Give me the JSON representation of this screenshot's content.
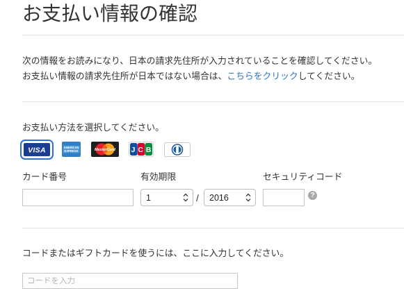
{
  "page": {
    "title": "お支払い情報の確認"
  },
  "notice": {
    "line1": "次の情報をお読みになり、日本の請求先住所が入力されていることを確認してください。",
    "line2_before_link": "お支払い情報の請求先住所が日本ではない場合は、",
    "line2_link": "こちらをクリック",
    "line2_after_link": "してください。"
  },
  "payment": {
    "prompt": "お支払い方法を選択してください。",
    "cards": [
      {
        "icon": "visa-card-icon",
        "logo_text": "VISA",
        "selected": true
      },
      {
        "icon": "amex-card-icon",
        "logo_lines": [
          "AMERICAN",
          "EXPRESS"
        ],
        "selected": false
      },
      {
        "icon": "mastercard-card-icon",
        "logo_text": "MasterCard",
        "selected": false
      },
      {
        "icon": "jcb-card-icon",
        "logo_text": "JCB",
        "selected": false
      },
      {
        "icon": "diners-club-card-icon",
        "selected": false
      }
    ],
    "fields": {
      "card_number": {
        "label": "カード番号",
        "value": ""
      },
      "expiry": {
        "label": "有効期限",
        "month": "1",
        "separator": "/",
        "year": "2016"
      },
      "security_code": {
        "label": "セキュリティコード",
        "value": "",
        "help_icon": "question-mark-icon"
      }
    }
  },
  "redeem": {
    "prompt": "コードまたはギフトカードを使うには、ここに入力してください。",
    "placeholder": "コードを入力",
    "value": ""
  },
  "colors": {
    "text": "#333333",
    "link": "#2f74c0",
    "selection": "#2b6fd4",
    "divider": "#e3e3e3",
    "input_border": "#c6c6c6",
    "help_icon": "#a9a9a9"
  }
}
